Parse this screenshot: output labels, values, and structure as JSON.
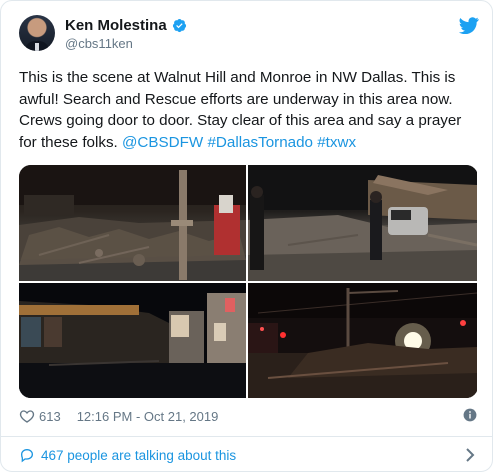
{
  "author": {
    "display_name": "Ken Molestina",
    "handle": "@cbs11ken",
    "verified": true
  },
  "tweet": {
    "text": "This is the scene at Walnut Hill and Monroe in NW Dallas. This is awful! Search and Rescue efforts are underway in this area now. Crews going door to door. Stay clear of this area and say a prayer for these folks. ",
    "links": [
      "@CBSDFW",
      "#DallasTornado",
      "#txwx"
    ]
  },
  "media": {
    "photos": [
      "photo-1",
      "photo-2",
      "photo-3",
      "photo-4"
    ]
  },
  "stats": {
    "likes": "613",
    "timestamp": "12:16 PM - Oct 21, 2019"
  },
  "conversation": {
    "label": "467 people are talking about this"
  },
  "colors": {
    "accent": "#1da1f2",
    "link": "#1b95e0",
    "secondary": "#657786",
    "text": "#14171a",
    "border": "#e1e8ed"
  },
  "icons": [
    "verified-badge-icon",
    "twitter-bird-icon",
    "heart-icon",
    "info-icon",
    "reply-icon",
    "chevron-right-icon"
  ]
}
